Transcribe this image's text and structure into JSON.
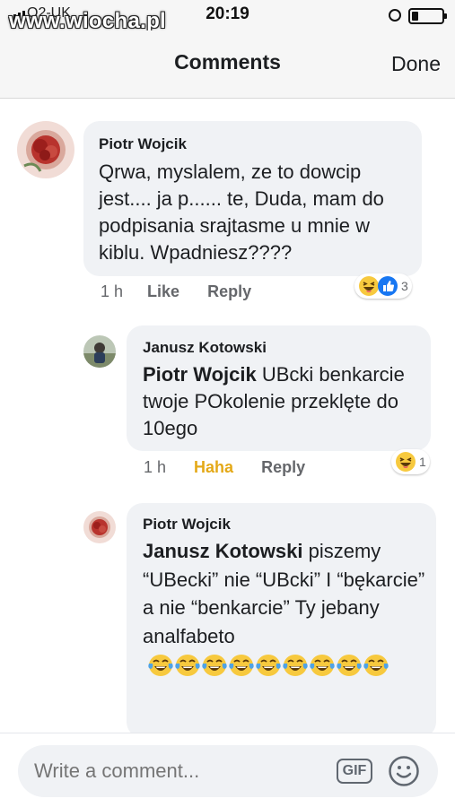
{
  "status_bar": {
    "carrier": "O2-UK",
    "watermark": "www.wiocha.pl",
    "time": "20:19",
    "icons": [
      "signal-icon",
      "alarm-icon",
      "battery-icon"
    ]
  },
  "header": {
    "title": "Comments",
    "done_label": "Done"
  },
  "comments": [
    {
      "author": "Piotr Wojcik",
      "text": "Qrwa, myslalem, ze to dowcip jest.... ja p...... te, Duda, mam do podpisania srajtasme u mnie w kiblu. Wpadniesz????",
      "time": "1 h",
      "like_label": "Like",
      "reply_label": "Reply",
      "reactions": {
        "icons": [
          "haha-reaction-icon",
          "like-reaction-icon"
        ],
        "count": "3"
      }
    },
    {
      "author": "Janusz Kotowski",
      "mention": "Piotr Wojcik",
      "text": " UBcki benkarcie twoje POkolenie przeklęte do 10ego",
      "time": "1 h",
      "like_label": "Haha",
      "reply_label": "Reply",
      "reactions": {
        "icons": [
          "haha-reaction-icon"
        ],
        "count": "1"
      }
    },
    {
      "author": "Piotr Wojcik",
      "mention": "Janusz Kotowski",
      "text": "  piszemy “UBecki” nie “UBcki” I “bękarcie” a nie “benkarcie” Ty jebany analfabeto",
      "emoji": "tears-of-joy-emoji",
      "emoji_count": 9
    }
  ],
  "composer": {
    "placeholder": "Write a comment...",
    "gif_label": "GIF",
    "emoji_button_icon": "smiley-icon"
  },
  "colors": {
    "bubble": "#f0f2f5",
    "meta_text": "#65676b",
    "haha_active": "#e4a918",
    "like_blue": "#1877f2"
  }
}
